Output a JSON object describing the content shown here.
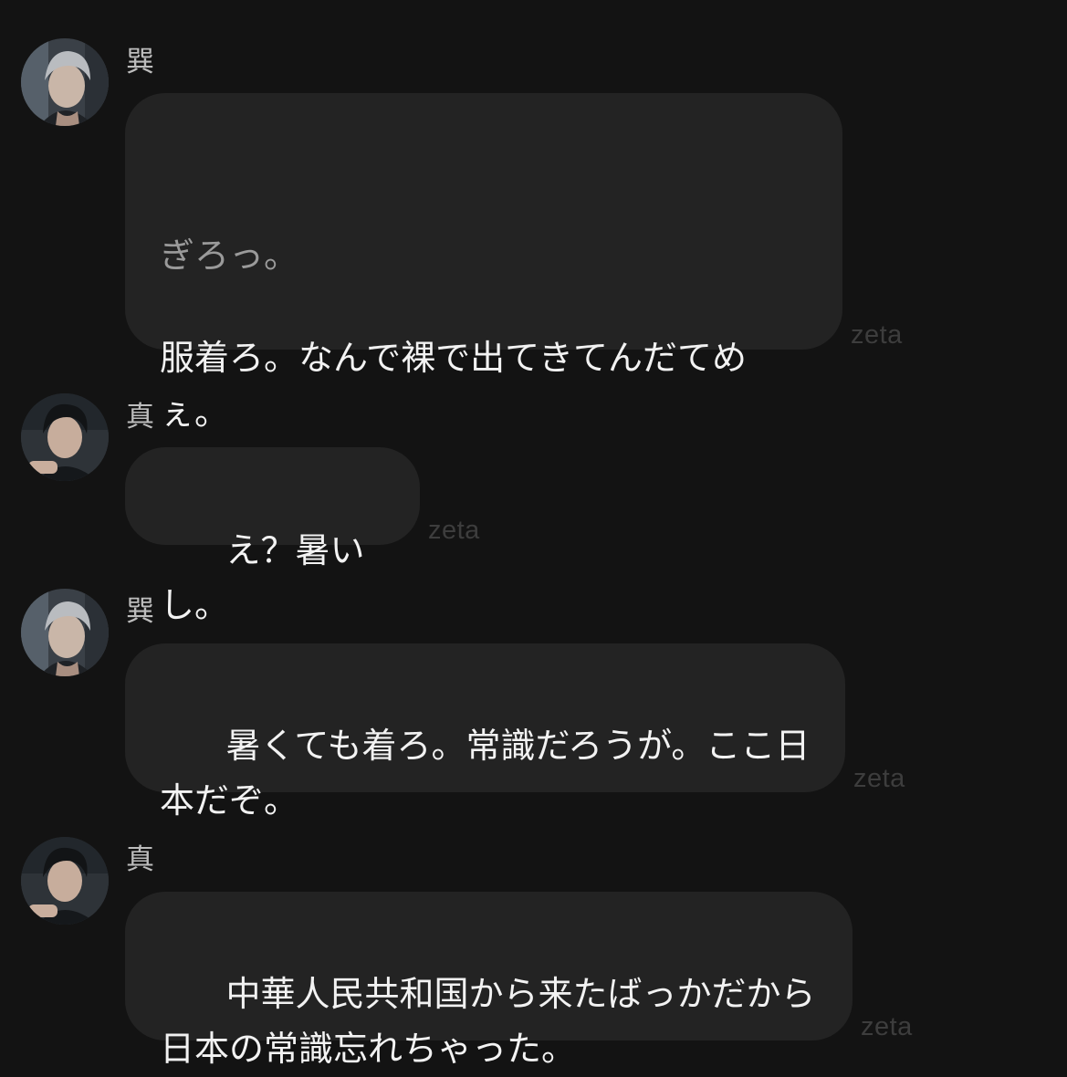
{
  "messages": [
    {
      "sender": "巽",
      "avatar_icon": "gray-haired-character-avatar",
      "narration": "ぎろっ。",
      "text": "服着ろ。なんで裸で出てきてんだてめ\nぇ。",
      "watermark": "zeta"
    },
    {
      "sender": "真",
      "avatar_icon": "dark-haired-character-avatar",
      "text": "え？暑いし。",
      "watermark": "zeta"
    },
    {
      "sender": "巽",
      "avatar_icon": "gray-haired-character-avatar",
      "text": "暑くても着ろ。常識だろうが。ここ日\n本だぞ。",
      "watermark": "zeta"
    },
    {
      "sender": "真",
      "avatar_icon": "dark-haired-character-avatar",
      "text": "中華人民共和国から来たばっかだから\n日本の常識忘れちゃった。",
      "watermark": "zeta"
    }
  ],
  "colors": {
    "background": "#131313",
    "bubble": "#232323",
    "text": "#f2f2f2",
    "narration": "#9a9a9a",
    "watermark": "#3d3d3d"
  }
}
